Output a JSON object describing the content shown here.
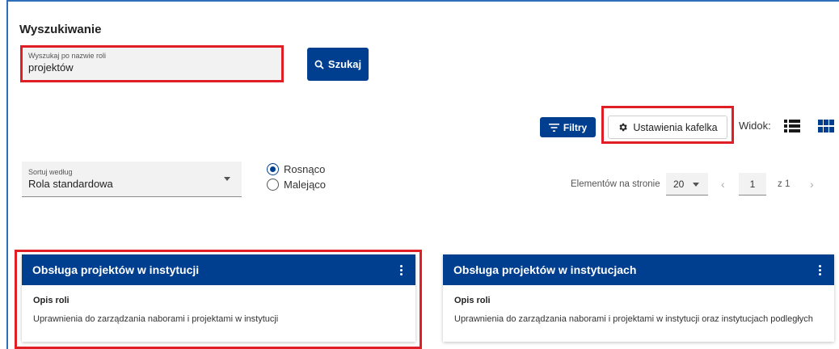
{
  "section": {
    "title": "Wyszukiwanie"
  },
  "search": {
    "label": "Wyszukaj po nazwie roli",
    "value": "projektów",
    "button_label": "Szukaj"
  },
  "toolbar": {
    "filters_label": "Filtry",
    "settings_label": "Ustawienia kafelka",
    "view_label": "Widok:"
  },
  "sort": {
    "label": "Sortuj według",
    "value": "Rola standardowa",
    "options": [
      {
        "label": "Rosnąco",
        "selected": true
      },
      {
        "label": "Malejąco",
        "selected": false
      }
    ]
  },
  "pagination": {
    "per_page_label": "Elementów na stronie",
    "per_page": "20",
    "page": "1",
    "of_label": "z 1"
  },
  "tiles": [
    {
      "title": "Obsługa projektów w instytucji",
      "subtitle": "Opis roli",
      "description": "Uprawnienia do zarządzania naborami i projektami w instytucji"
    },
    {
      "title": "Obsługa projektów w instytucjach",
      "subtitle": "Opis roli",
      "description": "Uprawnienia do zarządzania naborami i projektami w instytucji oraz instytucjach podległych"
    }
  ],
  "colors": {
    "primary": "#003f8f",
    "highlight": "#e01e26",
    "frame": "#2f6fba"
  },
  "icons": [
    "search-icon",
    "filter-icon",
    "gear-icon",
    "list-view-icon",
    "grid-view-icon",
    "kebab-menu-icon",
    "chevron-left-icon",
    "chevron-right-icon",
    "caret-down-icon"
  ]
}
